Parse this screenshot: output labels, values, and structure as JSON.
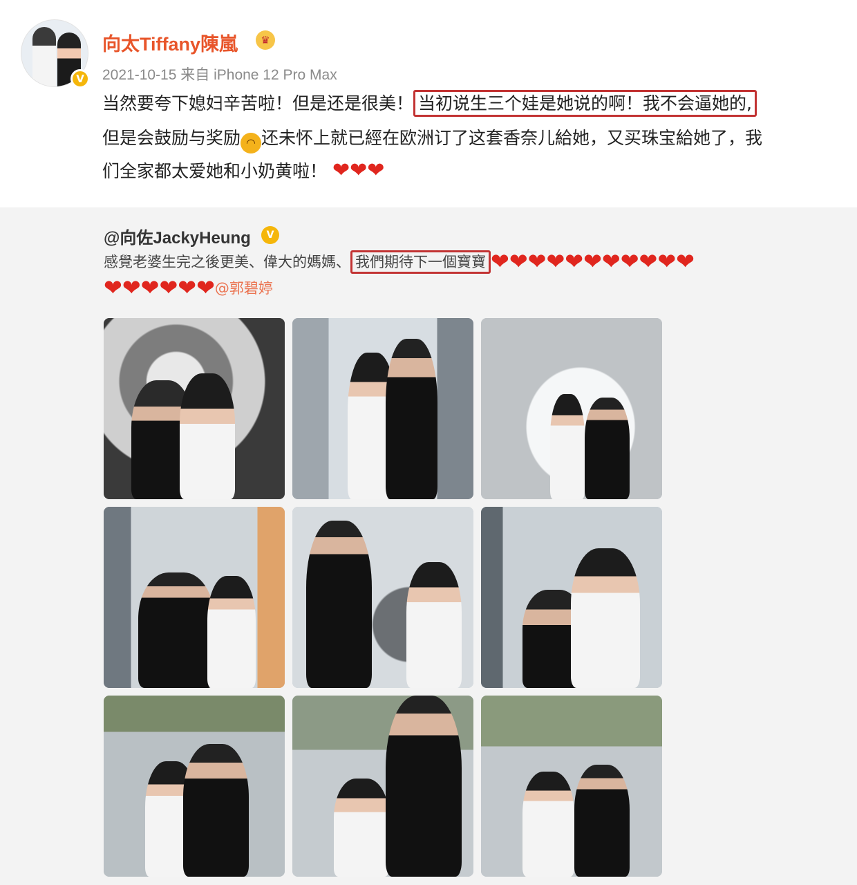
{
  "post": {
    "username": "向太Tiffany陳嵐",
    "crown_icon": "crown-emoji-icon",
    "meta": "2021-10-15  来自 iPhone 12 Pro Max",
    "line1_pre": "当然要夸下媳妇辛苦啦！但是还是很美！",
    "line1_highlight": "当初说生三个娃是她说的啊！我不会逼她的,",
    "line2_pre": "但是会鼓励与奖励",
    "line2_post": "还未怀上就已經在欧洲订了这套香奈儿給她，又买珠宝給她了，我",
    "line3": "们全家都太爱她和小奶黄啦！",
    "line3_hearts": "❤❤❤",
    "emoji_laugh": "😆"
  },
  "repost": {
    "username": "@向佐JackyHeung",
    "line1_pre": "感覺老婆生完之後更美、偉大的媽媽、",
    "line1_highlight": "我們期待下一個寶寶",
    "line1_hearts": "❤❤❤❤❤❤❤❤❤❤❤",
    "line2_hearts": "❤❤❤❤❤❤",
    "mention": "@郭碧婷"
  },
  "colors": {
    "username": "#e8552a",
    "highlight_border": "#c23333",
    "heart": "#e0261e",
    "verified": "#f5b60a",
    "repost_bg": "#f3f3f3",
    "mention": "#eb7350"
  },
  "photos": [
    {
      "name": "photo-1"
    },
    {
      "name": "photo-2"
    },
    {
      "name": "photo-3"
    },
    {
      "name": "photo-4"
    },
    {
      "name": "photo-5"
    },
    {
      "name": "photo-6"
    },
    {
      "name": "photo-7"
    },
    {
      "name": "photo-8"
    },
    {
      "name": "photo-9"
    }
  ]
}
